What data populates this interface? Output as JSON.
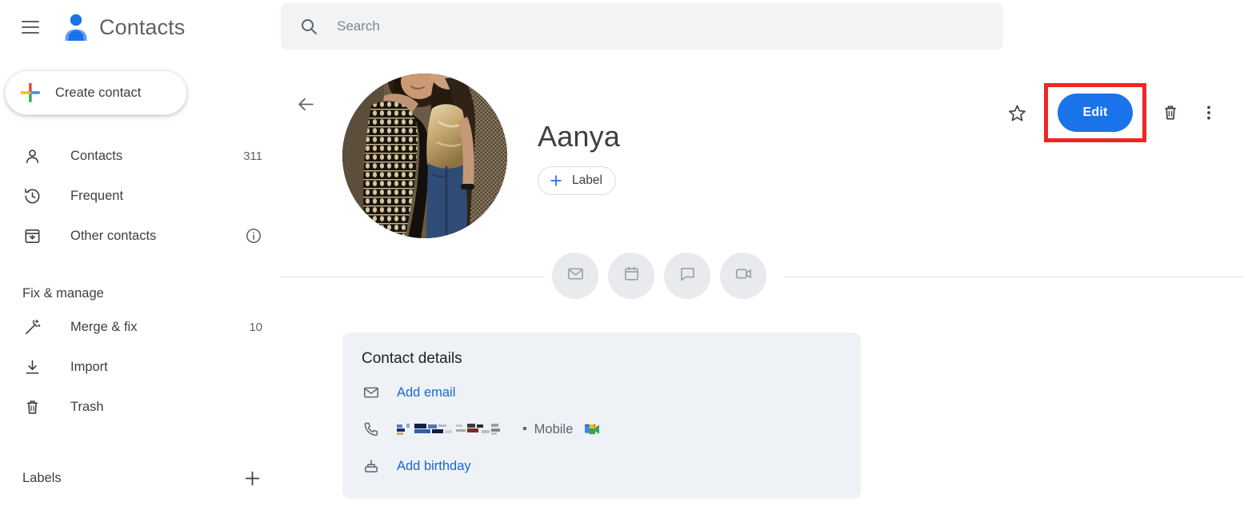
{
  "header": {
    "menu_icon": "hamburger-menu-icon",
    "logo_icon": "contacts-person-logo-icon",
    "title": "Contacts"
  },
  "search": {
    "icon": "search-icon",
    "placeholder": "Search",
    "value": ""
  },
  "sidebar": {
    "create_button": {
      "label": "Create contact",
      "icon": "google-plus-icon"
    },
    "items": [
      {
        "label": "Contacts",
        "count": "311",
        "icon": "person-icon"
      },
      {
        "label": "Frequent",
        "count": "",
        "icon": "history-clock-icon"
      },
      {
        "label": "Other contacts",
        "count": "",
        "icon": "archive-down-icon",
        "info_icon": "info-circle-icon"
      }
    ],
    "section_title": "Fix & manage",
    "manage_items": [
      {
        "label": "Merge & fix",
        "count": "10",
        "icon": "magic-wand-icon"
      },
      {
        "label": "Import",
        "count": "",
        "icon": "download-icon"
      },
      {
        "label": "Trash",
        "count": "",
        "icon": "trash-icon"
      }
    ],
    "labels_title": "Labels",
    "labels_add_icon": "plus-icon"
  },
  "contact": {
    "back_icon": "back-arrow-icon",
    "avatar_alt": "contact-photo",
    "name": "Aanya",
    "label_button": {
      "plus_icon": "plus-icon",
      "label": "Label"
    },
    "quick_actions": [
      {
        "name": "email-action",
        "icon": "envelope-icon"
      },
      {
        "name": "calendar-action",
        "icon": "calendar-icon"
      },
      {
        "name": "chat-action",
        "icon": "chat-bubble-icon"
      },
      {
        "name": "video-action",
        "icon": "video-camera-icon"
      }
    ],
    "toolbar": {
      "star_icon": "star-outline-icon",
      "edit_label": "Edit",
      "delete_icon": "trash-icon",
      "more_icon": "more-vertical-icon"
    },
    "details": {
      "title": "Contact details",
      "rows": [
        {
          "icon": "envelope-icon",
          "link": "Add email",
          "type": "link"
        },
        {
          "icon": "phone-icon",
          "value_redacted": true,
          "phone_type": "Mobile",
          "app_icon": "google-meet-icon",
          "type": "phone"
        },
        {
          "icon": "cake-icon",
          "link": "Add birthday",
          "type": "link"
        }
      ]
    }
  },
  "annotation": {
    "highlight_color": "#ef2626",
    "target": "edit-button"
  },
  "colors": {
    "accent_blue": "#1a73e8",
    "link_blue": "#1967d2",
    "card_bg": "#eef2f7",
    "search_bg": "#f1f3f4",
    "text_primary": "#3c4043",
    "text_secondary": "#5f6368"
  }
}
